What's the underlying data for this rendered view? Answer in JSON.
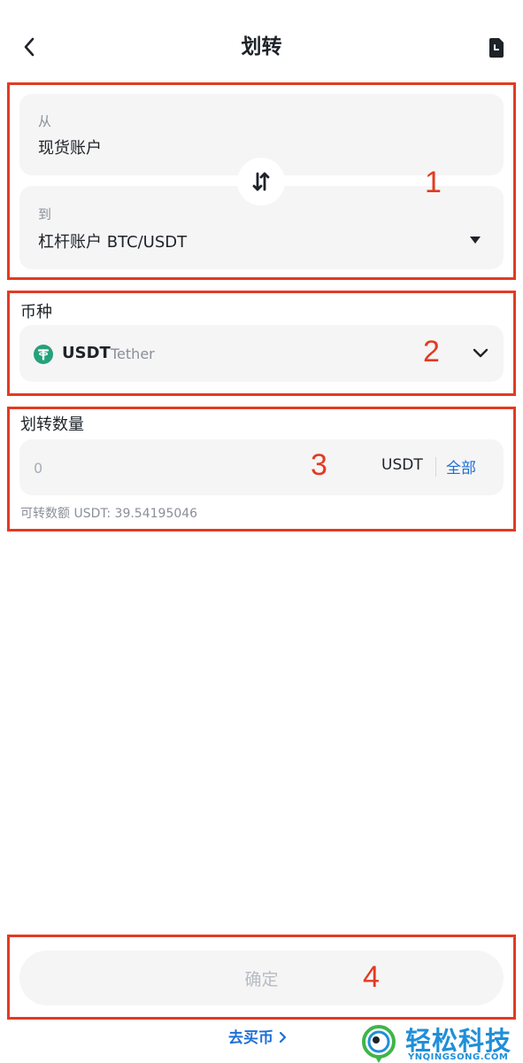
{
  "header": {
    "title": "划转",
    "back_icon": "chevron-left-icon",
    "history_icon": "transfer-record-icon"
  },
  "transfer": {
    "from_label": "从",
    "from_value": "现货账户",
    "to_label": "到",
    "to_value": "杠杆账户 BTC/USDT",
    "swap_icon": "swap-arrows-icon"
  },
  "coin": {
    "label": "币种",
    "symbol": "USDT",
    "name": "Tether",
    "icon_color": "#26a17b"
  },
  "amount": {
    "label": "划转数量",
    "placeholder": "0",
    "unit": "USDT",
    "all_label": "全部",
    "available_text": "可转数额 USDT: 39.54195046"
  },
  "actions": {
    "confirm_label": "确定",
    "buy_link": "去买币",
    "buy_link_icon": "chevron-right-icon"
  },
  "annotations": [
    "1",
    "2",
    "3",
    "4"
  ],
  "watermark": {
    "text": "轻松科技",
    "subtext": "YNQINGSONG.COM"
  },
  "colors": {
    "accent": "#1e6fd8",
    "annotation": "#e23b22",
    "card_bg": "#f5f5f5"
  }
}
